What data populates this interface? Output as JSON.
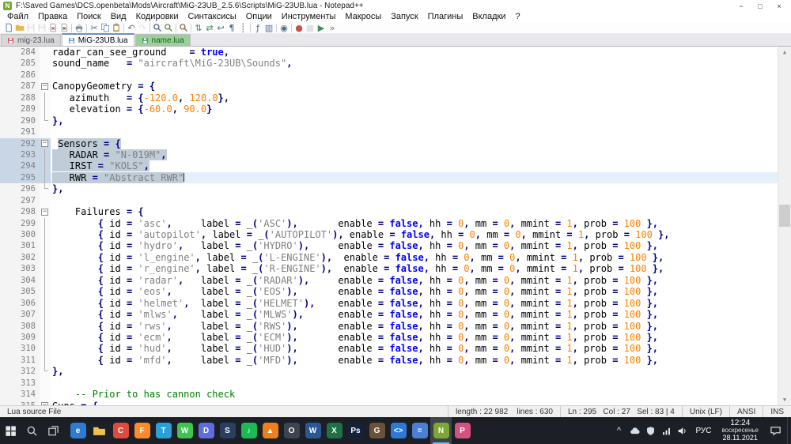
{
  "window": {
    "title": "F:\\Saved Games\\DCS.openbeta\\Mods\\Aircraft\\MiG-23UB_2.5.6\\Scripts\\MiG-23UB.lua - Notepad++",
    "app_icon": "N",
    "controls": {
      "minimize": "−",
      "maximize": "□",
      "close": "×"
    }
  },
  "menu": {
    "items": [
      "Файл",
      "Правка",
      "Поиск",
      "Вид",
      "Кодировки",
      "Синтаксисы",
      "Опции",
      "Инструменты",
      "Макросы",
      "Запуск",
      "Плагины",
      "Вкладки",
      "?"
    ]
  },
  "toolbar": {
    "items": [
      {
        "name": "new-file-button",
        "svg": "doc",
        "color": "#5b87c5"
      },
      {
        "name": "open-file-button",
        "svg": "folder",
        "color": "#e8b54a"
      },
      {
        "name": "save-button",
        "svg": "floppy",
        "color": "#b9b9b9",
        "disabled": true
      },
      {
        "name": "save-all-button",
        "svg": "floppy",
        "color": "#b9b9b9",
        "disabled": true
      },
      {
        "name": "close-file-button",
        "svg": "docx",
        "color": "#c75050"
      },
      {
        "name": "close-all-button",
        "svg": "docx",
        "color": "#8a4a4a"
      },
      {
        "sep": true
      },
      {
        "name": "print-button",
        "svg": "printer",
        "color": "#7b8a99"
      },
      {
        "sep": true
      },
      {
        "name": "cut-button",
        "glyph": "✂",
        "color": "#4a6b8a"
      },
      {
        "name": "copy-button",
        "svg": "copy",
        "color": "#5b87c5"
      },
      {
        "name": "paste-button",
        "svg": "clipboard",
        "color": "#b08a4a"
      },
      {
        "sep": true
      },
      {
        "name": "undo-button",
        "glyph": "↶",
        "color": "#7a5bb5"
      },
      {
        "name": "redo-button",
        "glyph": "↷",
        "color": "#b9b9b9",
        "disabled": true
      },
      {
        "sep": true
      },
      {
        "name": "find-button",
        "svg": "mag",
        "color": "#4a6b8a"
      },
      {
        "name": "replace-button",
        "svg": "mag",
        "color": "#6b8a4a"
      },
      {
        "sep": true
      },
      {
        "name": "zoom-in-button",
        "svg": "mag",
        "color": "#8a6b4a"
      },
      {
        "sep": true
      },
      {
        "name": "sync-vertical-scroll-button",
        "glyph": "⇅",
        "color": "#3f8f5f"
      },
      {
        "name": "sync-horizontal-scroll-button",
        "glyph": "⇄",
        "color": "#3f8f5f"
      },
      {
        "name": "word-wrap-button",
        "glyph": "↩",
        "color": "#4a6b8a"
      },
      {
        "name": "show-all-characters-button",
        "glyph": "¶",
        "color": "#4a6b8a"
      },
      {
        "name": "indent-guide-button",
        "glyph": "┊",
        "color": "#4a6b8a"
      },
      {
        "sep": true
      },
      {
        "name": "function-list-button",
        "glyph": "ƒ",
        "color": "#4a6b8a"
      },
      {
        "name": "document-map-button",
        "glyph": "▥",
        "color": "#4a6b8a"
      },
      {
        "sep": true
      },
      {
        "name": "monitoring-button",
        "glyph": "◉",
        "color": "#4a6b8a"
      },
      {
        "sep": true
      },
      {
        "name": "macro-record-button",
        "glyph": "●",
        "color": "#c75050"
      },
      {
        "name": "macro-stop-button",
        "glyph": "■",
        "color": "#b9b9b9",
        "disabled": true
      },
      {
        "name": "macro-play-button",
        "glyph": "▶",
        "color": "#3f8f5f"
      },
      {
        "name": "macro-run-button",
        "glyph": "»",
        "color": "#3f8f5f"
      }
    ]
  },
  "tabs": [
    {
      "label": "mig-23.lua",
      "state": "inactive",
      "icon_color": "#c75050"
    },
    {
      "label": "MiG-23UB.lua",
      "state": "active",
      "icon_color": "#5b87c5"
    },
    {
      "label": "name.lua",
      "state": "colored",
      "icon_color": "#3f8f5f"
    }
  ],
  "editor": {
    "failure_defaults": {
      "enable": "false",
      "hh": "0",
      "mm": "0",
      "mmint": "1",
      "prob": "100"
    },
    "lines": [
      {
        "n": 284,
        "segs": [
          [
            "radar_can_see_ground",
            "d"
          ],
          [
            "    ",
            "d"
          ],
          [
            "= ",
            "o"
          ],
          [
            "true",
            "k"
          ],
          [
            ",",
            "o"
          ]
        ]
      },
      {
        "n": 285,
        "segs": [
          [
            "sound_name",
            "d"
          ],
          [
            "   ",
            "d"
          ],
          [
            "= ",
            "o"
          ],
          [
            "\"aircraft\\MiG-23UB\\Sounds\"",
            "s"
          ],
          [
            ",",
            "o"
          ]
        ]
      },
      {
        "n": 286,
        "segs": []
      },
      {
        "n": 287,
        "fold": "open",
        "segs": [
          [
            "CanopyGeometry ",
            "d"
          ],
          [
            "= {",
            "o"
          ]
        ]
      },
      {
        "n": 288,
        "fold": "line",
        "segs": [
          [
            "   azimuth   ",
            "d"
          ],
          [
            "= {",
            "o"
          ],
          [
            "-120.0",
            "n"
          ],
          [
            ", ",
            "o"
          ],
          [
            "120.0",
            "n"
          ],
          [
            "},",
            "o"
          ]
        ]
      },
      {
        "n": 289,
        "fold": "line",
        "segs": [
          [
            "   elevation ",
            "d"
          ],
          [
            "= {",
            "o"
          ],
          [
            "-60.0",
            "n"
          ],
          [
            ", ",
            "o"
          ],
          [
            "90.0",
            "n"
          ],
          [
            "}",
            "o"
          ]
        ]
      },
      {
        "n": 290,
        "fold": "end",
        "segs": [
          [
            "},",
            "o"
          ]
        ]
      },
      {
        "n": 291,
        "segs": []
      },
      {
        "n": 292,
        "fold": "open",
        "gutsel": true,
        "segs": [
          [
            " ",
            "d"
          ],
          [
            "Sensors ",
            "d",
            1
          ],
          [
            "= {",
            "o",
            1
          ]
        ]
      },
      {
        "n": 293,
        "fold": "line",
        "gutsel": true,
        "segs": [
          [
            "   RADAR ",
            "d",
            1
          ],
          [
            "= ",
            "o",
            1
          ],
          [
            "\"N-019M\"",
            "s",
            1
          ],
          [
            ",",
            "o",
            1
          ]
        ]
      },
      {
        "n": 294,
        "fold": "line",
        "gutsel": true,
        "segs": [
          [
            "   IRST ",
            "d",
            1
          ],
          [
            "= ",
            "o",
            1
          ],
          [
            "\"KOLS\"",
            "s",
            1
          ],
          [
            ",",
            "o",
            1
          ]
        ]
      },
      {
        "n": 295,
        "fold": "line",
        "gutsel": true,
        "current": true,
        "segs": [
          [
            "   RWR ",
            "d",
            1
          ],
          [
            "= ",
            "o",
            1
          ],
          [
            "\"Abstract RWR\"",
            "s",
            1
          ]
        ]
      },
      {
        "n": 296,
        "fold": "end",
        "segs": [
          [
            "},",
            "o"
          ]
        ]
      },
      {
        "n": 297,
        "segs": []
      },
      {
        "n": 298,
        "fold": "open",
        "segs": [
          [
            "    Failures ",
            "d"
          ],
          [
            "= {",
            "o"
          ]
        ]
      },
      {
        "n": 299,
        "fold": "line",
        "fail": {
          "id": "asc",
          "label": "ASC"
        }
      },
      {
        "n": 300,
        "fold": "line",
        "fail": {
          "id": "autopilot",
          "label": "AUTOPILOT"
        }
      },
      {
        "n": 301,
        "fold": "line",
        "fail": {
          "id": "hydro",
          "label": "HYDRO"
        }
      },
      {
        "n": 302,
        "fold": "line",
        "fail": {
          "id": "l_engine",
          "label": "L-ENGINE"
        }
      },
      {
        "n": 303,
        "fold": "line",
        "fail": {
          "id": "r_engine",
          "label": "R-ENGINE"
        }
      },
      {
        "n": 304,
        "fold": "line",
        "fail": {
          "id": "radar",
          "label": "RADAR"
        }
      },
      {
        "n": 305,
        "fold": "line",
        "fail": {
          "id": "eos",
          "label": "EOS"
        }
      },
      {
        "n": 306,
        "fold": "line",
        "fail": {
          "id": "helmet",
          "label": "HELMET"
        }
      },
      {
        "n": 307,
        "fold": "line",
        "fail": {
          "id": "mlws",
          "label": "MLWS"
        }
      },
      {
        "n": 308,
        "fold": "line",
        "fail": {
          "id": "rws",
          "label": "RWS"
        }
      },
      {
        "n": 309,
        "fold": "line",
        "fail": {
          "id": "ecm",
          "label": "ECM"
        }
      },
      {
        "n": 310,
        "fold": "line",
        "fail": {
          "id": "hud",
          "label": "HUD"
        }
      },
      {
        "n": 311,
        "fold": "line",
        "fail": {
          "id": "mfd",
          "label": "MFD"
        }
      },
      {
        "n": 312,
        "fold": "end",
        "segs": [
          [
            "},",
            "o"
          ]
        ]
      },
      {
        "n": 313,
        "segs": []
      },
      {
        "n": 314,
        "segs": [
          [
            "    ",
            "d"
          ],
          [
            "-- Prior to has cannon check",
            "c"
          ]
        ]
      },
      {
        "n": 315,
        "fold": "open",
        "segs": [
          [
            "Guns ",
            "d"
          ],
          [
            "= {",
            "o"
          ]
        ]
      }
    ]
  },
  "statusbar": {
    "doc_type": "Lua source File",
    "length_lines": "length : 22 982    lines : 630",
    "position": "Ln : 295   Col : 27   Sel : 83 | 4",
    "eol": "Unix (LF)",
    "encoding": "ANSI",
    "insert_mode": "INS"
  },
  "taskbar": {
    "system": [
      {
        "name": "start-button",
        "svg": "startwin",
        "color": "#e8e8e8"
      },
      {
        "name": "search-button",
        "svg": "search",
        "color": "#cfcfcf"
      },
      {
        "name": "task-view-button",
        "svg": "taskview",
        "color": "#cfcfcf"
      }
    ],
    "apps": [
      {
        "name": "microsoft-edge",
        "glyph": "e",
        "color": "#2e7bd4"
      },
      {
        "name": "file-explorer",
        "svg": "folder",
        "color": "#f2c04e"
      },
      {
        "name": "google-chrome",
        "glyph": "C",
        "color": "#e0493c"
      },
      {
        "name": "mozilla-firefox",
        "glyph": "F",
        "color": "#ff8a2a"
      },
      {
        "name": "telegram",
        "glyph": "T",
        "color": "#2aa0d6"
      },
      {
        "name": "whatsapp",
        "glyph": "W",
        "color": "#3fc351"
      },
      {
        "name": "discord",
        "glyph": "D",
        "color": "#5f6ce0"
      },
      {
        "name": "steam",
        "glyph": "S",
        "color": "#2a3f5f"
      },
      {
        "name": "spotify",
        "glyph": "♪",
        "color": "#1db954"
      },
      {
        "name": "vlc-player",
        "glyph": "▲",
        "color": "#ef7f1a"
      },
      {
        "name": "obs-studio",
        "glyph": "O",
        "color": "#3d4450"
      },
      {
        "name": "microsoft-word",
        "glyph": "W",
        "color": "#2b5797"
      },
      {
        "name": "microsoft-excel",
        "glyph": "X",
        "color": "#1e7145"
      },
      {
        "name": "photoshop",
        "glyph": "Ps",
        "color": "#14213d"
      },
      {
        "name": "gimp",
        "glyph": "G",
        "color": "#6b5138"
      },
      {
        "name": "vs-code",
        "glyph": "<>",
        "color": "#2c7ad6"
      },
      {
        "name": "calculator",
        "glyph": "=",
        "color": "#4a7fd4"
      },
      {
        "name": "notepad-plus-plus",
        "glyph": "N",
        "color": "#7da836",
        "active": true
      },
      {
        "name": "paint",
        "glyph": "P",
        "color": "#d4527f"
      }
    ],
    "tray": [
      {
        "name": "hidden-icons-button",
        "glyph": "^"
      },
      {
        "name": "onedrive-icon",
        "svg": "cloud",
        "color": "#d7dee8"
      },
      {
        "name": "security-shield-icon",
        "svg": "shield",
        "color": "#d7dee8"
      },
      {
        "name": "network-icon",
        "svg": "wifi",
        "color": "#e8e8e8"
      },
      {
        "name": "volume-icon",
        "svg": "volume",
        "color": "#e8e8e8"
      }
    ],
    "language": "РУС",
    "clock": {
      "time": "12:24",
      "weekday": "воскресенье",
      "date": "28.11.2021"
    }
  }
}
